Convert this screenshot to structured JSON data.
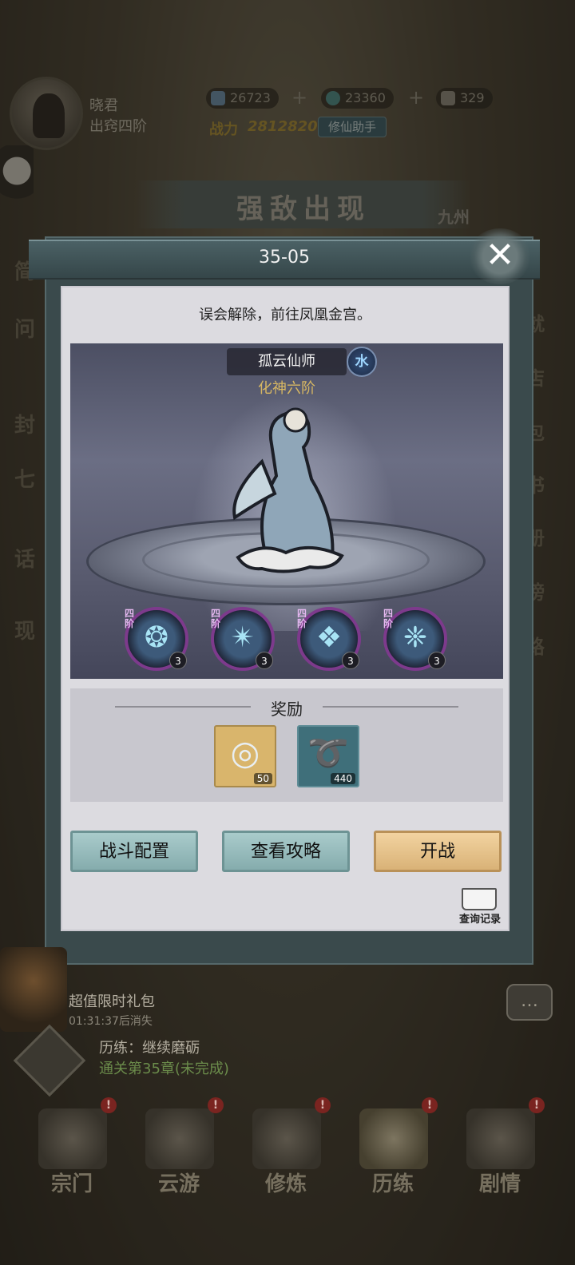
{
  "player": {
    "name": "晓君",
    "rank": "出窍四阶",
    "power_label": "战力",
    "power_value": "2812820",
    "helper_label": "修仙助手"
  },
  "resources": [
    {
      "icon": "jade-icon",
      "value": "26723"
    },
    {
      "icon": "spirit-stone-icon",
      "value": "23360"
    },
    {
      "icon": "scroll-icon",
      "value": "329"
    }
  ],
  "banner": {
    "title": "强敌出现",
    "side_label": "九州"
  },
  "dialog": {
    "title": "35-05",
    "description": "误会解除，前往凤凰金宫。",
    "boss": {
      "name": "孤云仙师",
      "element": "水",
      "rank": "化神六阶"
    },
    "skills": [
      {
        "tier": "四阶",
        "level": "3",
        "icon": "water-swirl-icon",
        "glyph": "❂"
      },
      {
        "tier": "四阶",
        "level": "3",
        "icon": "ice-burst-icon",
        "glyph": "✴"
      },
      {
        "tier": "四阶",
        "level": "3",
        "icon": "ice-shard-icon",
        "glyph": "❖"
      },
      {
        "tier": "四阶",
        "level": "3",
        "icon": "ice-spikes-icon",
        "glyph": "❈"
      }
    ],
    "rewards_title": "奖励",
    "rewards": [
      {
        "icon": "jade-ring-icon",
        "count": "50",
        "glyph": "◎",
        "bg": "#d9b56c"
      },
      {
        "icon": "wind-swirl-icon",
        "count": "440",
        "glyph": "➰",
        "bg": "#3f6f7a"
      }
    ],
    "buttons": {
      "battle_config": "战斗配置",
      "view_guide": "查看攻略",
      "start_battle": "开战"
    },
    "query_log_label": "查询记录"
  },
  "side_left": [
    "简",
    "问",
    "封",
    "七",
    "话",
    "现"
  ],
  "side_right": [
    "就",
    "店",
    "包",
    "书",
    "册",
    "榜",
    "路"
  ],
  "promo": {
    "title": "超值限时礼包",
    "timer": "01:31:37后消失"
  },
  "quest": {
    "title": "历练：继续磨砺",
    "subtitle": "通关第35章(未完成)"
  },
  "nav": [
    {
      "label": "宗门",
      "alert": "!"
    },
    {
      "label": "云游",
      "alert": "!"
    },
    {
      "label": "修炼",
      "alert": "!"
    },
    {
      "label": "历练",
      "alert": "!"
    },
    {
      "label": "剧情",
      "alert": "!"
    }
  ],
  "colors": {
    "gold_button": "#d9b277",
    "teal_button": "#85acad",
    "dialog_body": "#dcdbe0"
  }
}
